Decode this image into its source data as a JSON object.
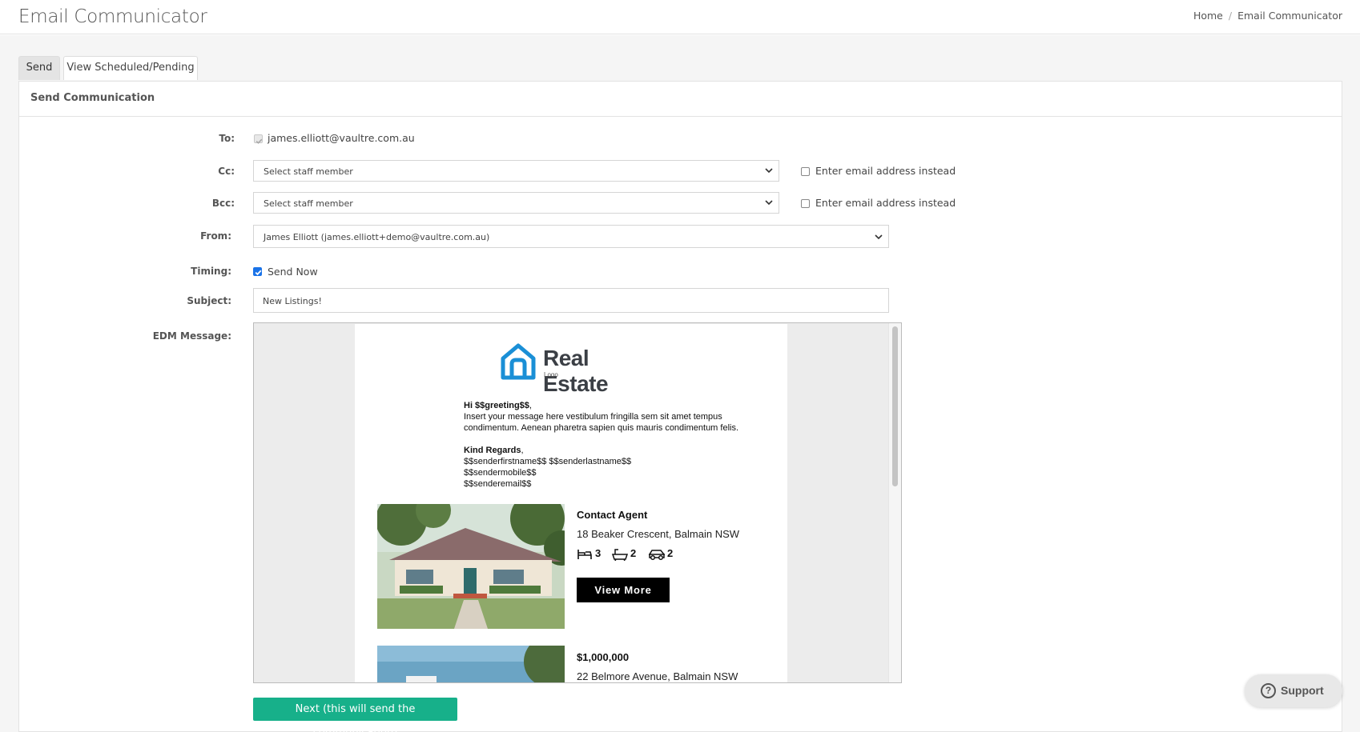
{
  "header": {
    "title": "Email Communicator",
    "breadcrumb": {
      "home": "Home",
      "separator": "/",
      "current": "Email Communicator"
    }
  },
  "tabs": [
    {
      "label": "Send",
      "active": true
    },
    {
      "label": "View Scheduled/Pending",
      "active": false
    }
  ],
  "panel": {
    "title": "Send Communication"
  },
  "form": {
    "to": {
      "label": "To:",
      "value": "james.elliott@vaultre.com.au",
      "checked": true,
      "disabled": true
    },
    "cc": {
      "label": "Cc:",
      "selected": "Select staff member",
      "alt_label": "Enter email address instead",
      "alt_checked": false
    },
    "bcc": {
      "label": "Bcc:",
      "selected": "Select staff member",
      "alt_label": "Enter email address instead",
      "alt_checked": false
    },
    "from": {
      "label": "From:",
      "selected": "James Elliott (james.elliott+demo@vaultre.com.au)"
    },
    "timing": {
      "label": "Timing:",
      "option_label": "Send Now",
      "checked": true
    },
    "subject": {
      "label": "Subject:",
      "value": "New Listings!"
    },
    "edm": {
      "label": "EDM Message:"
    }
  },
  "edm": {
    "logo": {
      "name": "Real Estate",
      "sub": "Logo",
      "color": "#1a8fd6"
    },
    "greeting_label": "Hi $$greeting$$",
    "greeting_punct": ",",
    "body": [
      "Insert your message here vestibulum fringilla sem sit amet tempus",
      "condimentum. Aenean pharetra sapien quis mauris condimentum felis."
    ],
    "signoff": "Kind Regards",
    "signoff_punct": ",",
    "signature": [
      "$$senderfirstname$$ $$senderlastname$$",
      "$$sendermobile$$",
      "$$senderemail$$"
    ],
    "listings": [
      {
        "title": "Contact Agent",
        "address": "18 Beaker Crescent, Balmain NSW",
        "beds": "3",
        "baths": "2",
        "cars": "2",
        "button": "View More"
      },
      {
        "title": "$1,000,000",
        "address": "22 Belmore Avenue, Balmain NSW"
      }
    ]
  },
  "actions": {
    "next_label": "Next (this will send the communication)"
  },
  "support": {
    "label": "Support",
    "icon": "?"
  },
  "colors": {
    "primary_button": "#17b08a",
    "checkbox": "#1a73e8",
    "logo": "#1a8fd6"
  }
}
